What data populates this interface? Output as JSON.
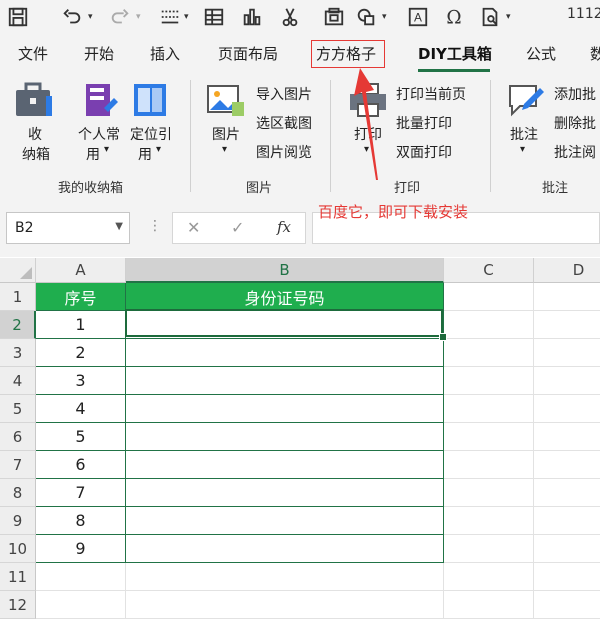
{
  "qat": {
    "title": "1112",
    "icons": [
      "save-icon",
      "undo-icon",
      "redo-icon",
      "format-painter-icon",
      "table-icon",
      "chart-icon",
      "cut-icon",
      "camera-icon",
      "shapes-icon",
      "text-box-icon",
      "symbol-icon",
      "print-preview-icon"
    ]
  },
  "tabs": [
    "文件",
    "开始",
    "插入",
    "页面布局",
    "方方格子",
    "DIY工具箱",
    "公式",
    "数"
  ],
  "active_tab": "DIY工具箱",
  "ribbon": {
    "favorites": {
      "group_label": "我的收纳箱",
      "collect_line1": "收",
      "collect_line2": "纳箱",
      "personal_line1": "个人常",
      "personal_line2": "用",
      "locate_line1": "定位引",
      "locate_line2": "用"
    },
    "picture": {
      "group_label": "图片",
      "big_label": "图片",
      "items": [
        "导入图片",
        "选区截图",
        "图片阅览"
      ]
    },
    "print": {
      "group_label": "打印",
      "big_label": "打印",
      "items": [
        "打印当前页",
        "批量打印",
        "双面打印"
      ]
    },
    "comment": {
      "group_label": "批注",
      "big_label": "批注",
      "items": [
        "添加批",
        "删除批",
        "批注阅"
      ]
    }
  },
  "annotation": "百度它，即可下载安装",
  "formula_bar": {
    "name_box": "B2",
    "cancel_glyph": "✕",
    "enter_glyph": "✓",
    "fx_label": "fx",
    "formula": ""
  },
  "sheet": {
    "columns": [
      "A",
      "B",
      "C",
      "D"
    ],
    "selected_column": "B",
    "rows": [
      "1",
      "2",
      "3",
      "4",
      "5",
      "6",
      "7",
      "8",
      "9",
      "10",
      "11",
      "12"
    ],
    "selected_row": "2",
    "header": {
      "a": "序号",
      "b": "身份证号码"
    },
    "data": [
      {
        "a": "1",
        "b": ""
      },
      {
        "a": "2",
        "b": ""
      },
      {
        "a": "3",
        "b": ""
      },
      {
        "a": "4",
        "b": ""
      },
      {
        "a": "5",
        "b": ""
      },
      {
        "a": "6",
        "b": ""
      },
      {
        "a": "7",
        "b": ""
      },
      {
        "a": "8",
        "b": ""
      },
      {
        "a": "9",
        "b": ""
      }
    ]
  },
  "colors": {
    "accent": "#217346",
    "table_header": "#1fae4e",
    "annotation": "#e53935"
  }
}
